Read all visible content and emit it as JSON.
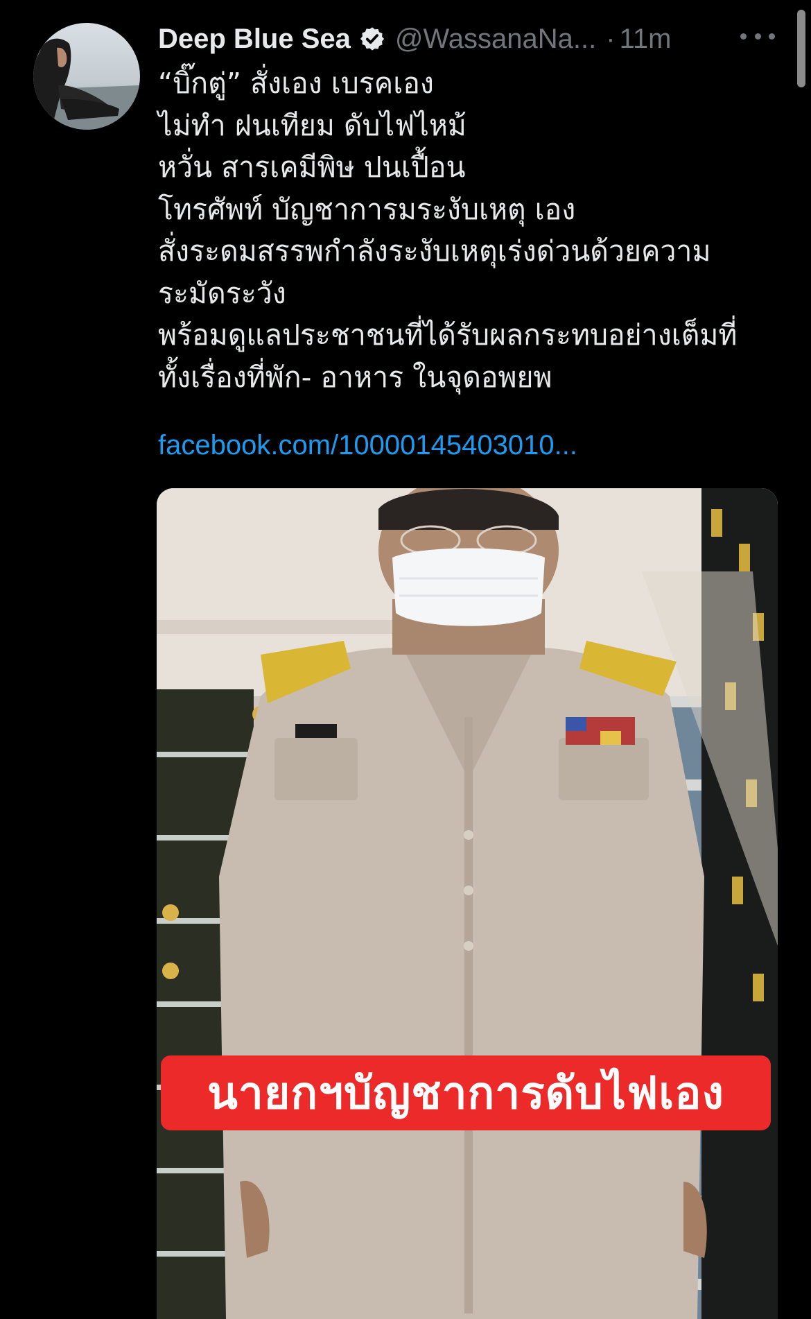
{
  "tweet": {
    "display_name": "Deep Blue Sea",
    "handle": "@WassanaNa...",
    "separator": "·",
    "time": "11m",
    "lines": [
      "“บิ๊กตู่” สั่งเอง เบรคเอง",
      "ไม่ทำ ฝนเทียม ดับไฟไหม้",
      "หวั่น สารเคมีพิษ ปนเปื้อน",
      "โทรศัพท์ บัญชาการมระงับเหตุ เอง",
      "สั่งระดมสรรพกำลังระงับเหตุเร่งด่วนด้วยความ",
      "ระมัดระวัง",
      "พร้อมดูแลประชาชนที่ได้รับผลกระทบอย่างเต็มที่",
      "ทั้งเรื่องที่พัก- อาหาร ในจุดอพยพ"
    ],
    "link": "facebook.com/10000145403010...",
    "media_caption": "นายกฯบัญชาการดับไฟเอง"
  },
  "icons": {
    "verified": "verified-badge-icon",
    "more": "more-horizontal-icon"
  },
  "colors": {
    "background": "#000000",
    "text": "#e7e9ea",
    "secondary": "#71767b",
    "link": "#1d9bf0",
    "caption_bg": "#ec2a2a"
  }
}
